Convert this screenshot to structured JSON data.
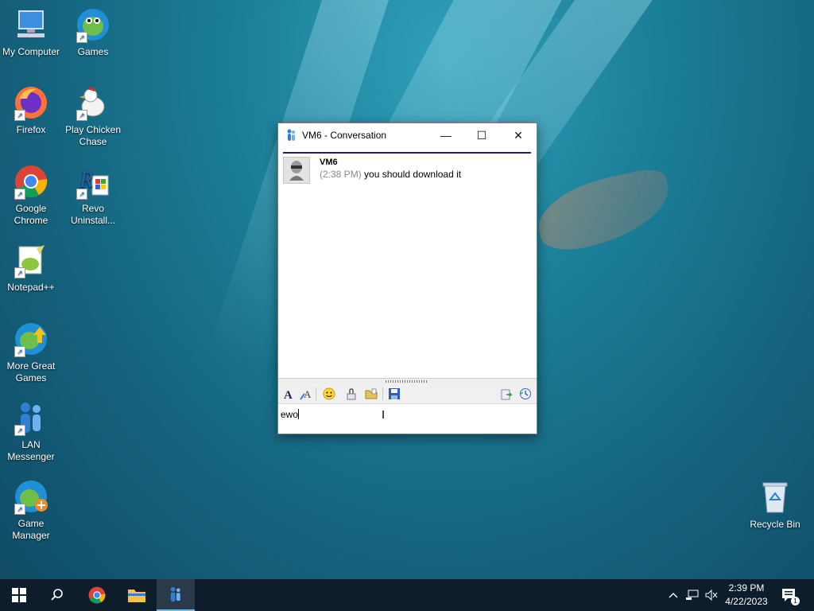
{
  "desktop": {
    "icons": [
      {
        "label": "My Computer"
      },
      {
        "label": "Games"
      },
      {
        "label": "Firefox"
      },
      {
        "label": "Play Chicken Chase"
      },
      {
        "label": "Google Chrome"
      },
      {
        "label": "Revo Uninstall..."
      },
      {
        "label": "Notepad++"
      },
      {
        "label": "More Great Games"
      },
      {
        "label": "LAN Messenger"
      },
      {
        "label": "Game Manager"
      },
      {
        "label": "Recycle Bin"
      }
    ]
  },
  "window": {
    "title": "VM6 - Conversation",
    "minimize": "—",
    "maximize": "☐",
    "close": "✕"
  },
  "conversation": {
    "messages": [
      {
        "sender": "VM6",
        "time": "(2:38 PM)",
        "text": "you should download it"
      }
    ]
  },
  "input": {
    "value": "ewo"
  },
  "taskbar": {
    "clock_time": "2:39 PM",
    "clock_date": "4/22/2023",
    "notification_count": "1"
  },
  "colors": {
    "accent": "#1c1c7a",
    "taskbar": "#0d1d2b",
    "active_indicator": "#76b9ed"
  }
}
